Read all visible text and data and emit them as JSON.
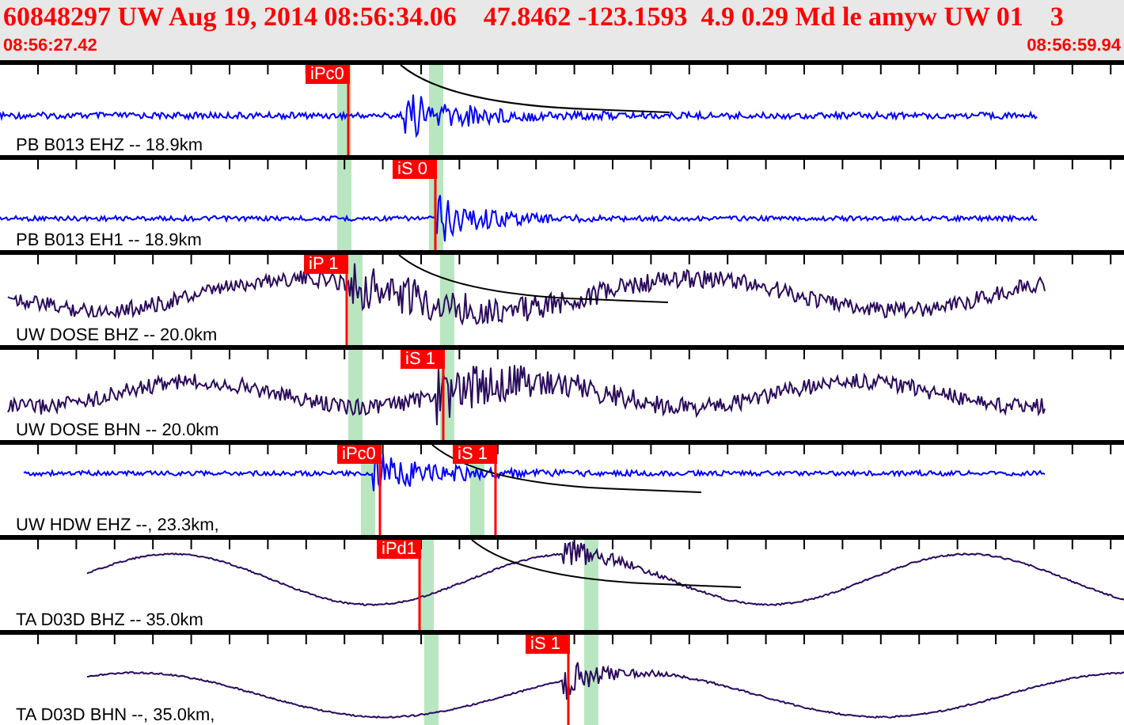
{
  "header": {
    "title": "60848297 UW Aug 19, 2014 08:56:34.06    47.8462 -123.1593  4.9 0.29 Md le amyw UW 01    3",
    "start_time": "08:56:27.42",
    "end_time": "08:56:59.94"
  },
  "traces": [
    {
      "label": "PB B013 EHZ -- 18.9km",
      "color": "#0000ff",
      "picks": [
        {
          "label": "iPc0"
        }
      ]
    },
    {
      "label": "PB B013 EH1 -- 18.9km",
      "color": "#0000ff",
      "picks": [
        {
          "label": "iS 0"
        }
      ]
    },
    {
      "label": "UW DOSE BHZ -- 20.0km",
      "color": "#2a0a5c",
      "picks": [
        {
          "label": "iP 1"
        }
      ]
    },
    {
      "label": "UW DOSE BHN -- 20.0km",
      "color": "#2a0a5c",
      "picks": [
        {
          "label": "iS 1"
        }
      ]
    },
    {
      "label": "UW HDW EHZ --, 23.3km,",
      "color": "#0000ff",
      "picks": [
        {
          "label": "iPc0"
        },
        {
          "label": "iS 1"
        }
      ]
    },
    {
      "label": "TA D03D BHZ -- 35.0km",
      "color": "#2a0a5c",
      "picks": [
        {
          "label": "iPd1"
        }
      ]
    },
    {
      "label": "TA D03D BHN --, 35.0km,",
      "color": "#2a0a5c",
      "picks": [
        {
          "label": "iS 1"
        }
      ]
    }
  ]
}
